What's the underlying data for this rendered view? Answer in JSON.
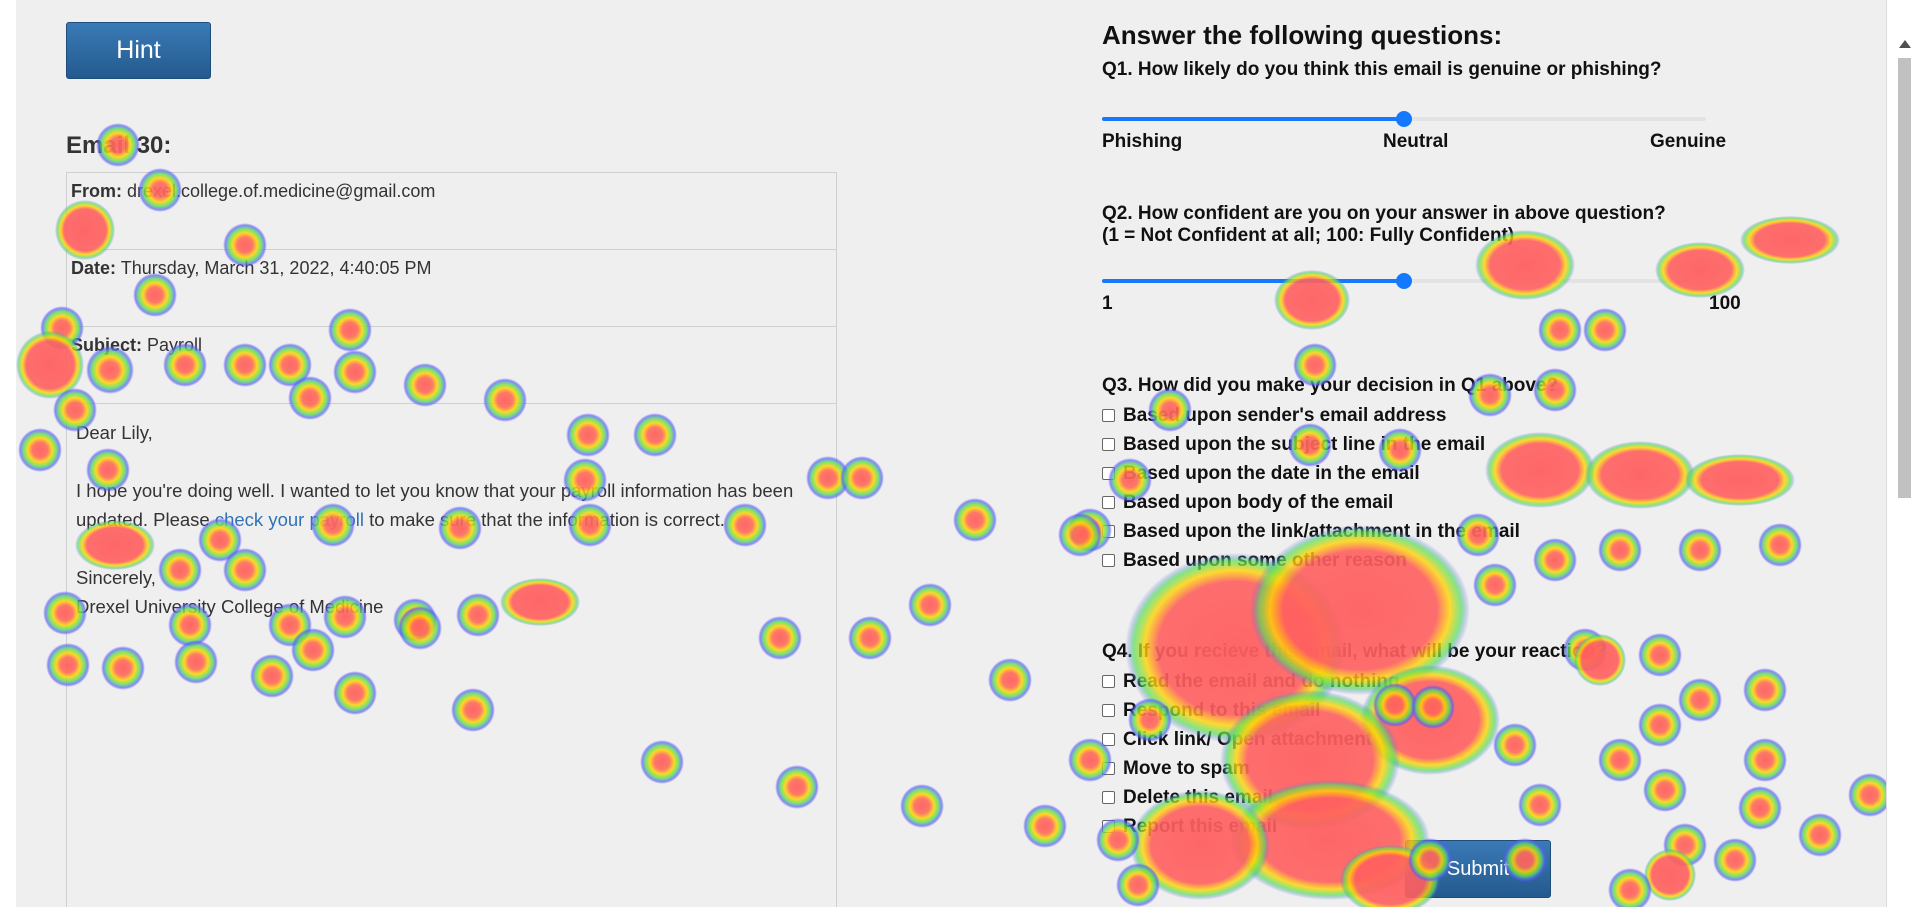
{
  "hint_button": {
    "label": "Hint"
  },
  "email": {
    "title": "Email 30:",
    "from_label": "From:",
    "from_value": "drexel.college.of.medicine@gmail.com",
    "date_label": "Date:",
    "date_value": "Thursday, March 31, 2022, 4:40:05 PM",
    "subject_label": "Subject:",
    "subject_value": "Payroll",
    "greeting": "Dear Lily,",
    "body_before_link": "I hope you're doing well. I wanted to let you know that your payroll information has been updated. Please ",
    "link_text": "check your payroll",
    "body_after_link": " to make sure that the information is correct.",
    "closing": "Sincerely,",
    "signature": "Drexel University College of Medicine"
  },
  "questions": {
    "heading": "Answer the following questions:",
    "q1": {
      "text": "Q1. How likely do you think this email is genuine or phishing?",
      "value_percent": 50,
      "label_left": "Phishing",
      "label_mid": "Neutral",
      "label_right": "Genuine"
    },
    "q2": {
      "text_line1": "Q2. How confident are you on your answer in above question?",
      "text_line2": "(1 = Not Confident at all; 100: Fully Confident)",
      "value_percent": 50,
      "label_left": "1",
      "label_right": "100"
    },
    "q3": {
      "text": "Q3. How did you make your decision in Q1 above?",
      "options": [
        "Based upon sender's email address",
        "Based upon the subject line in the email",
        "Based upon the date in the email",
        "Based upon body of the email",
        "Based upon the link/attachment in the email",
        "Based upon some other reason"
      ]
    },
    "q4": {
      "text": "Q4. If you recieve this email, what will be your reaction?",
      "options": [
        "Read the email and do nothing",
        "Respond to this email",
        "Click link/ Open attachment",
        "Move to spam",
        "Delete this email",
        "Report this email"
      ]
    }
  },
  "submit_button": {
    "label": "Submit"
  },
  "colors": {
    "button_blue": "#2d6aa3",
    "slider_blue": "#1479ff",
    "link_blue": "#2f73b5",
    "heat_core": "#ff5f5f",
    "heat_mid": "#ffd400",
    "heat_outer": "#5a5aff"
  }
}
